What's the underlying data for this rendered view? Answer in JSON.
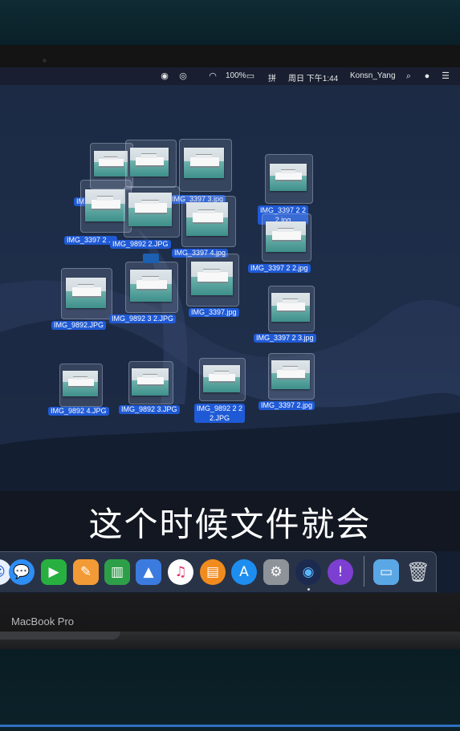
{
  "menubar": {
    "battery": "100%",
    "input_method": "拼",
    "datetime": "周日 下午1:44",
    "user": "Konsn_Yang"
  },
  "files": [
    {
      "name": "IMG_3397 2 2 2.jpg"
    },
    {
      "name": "IMG_3397 3.jpg"
    },
    {
      "name": "IMG_9892 2.JPG"
    },
    {
      "name": "IMG_3397 4.jpg"
    },
    {
      "name": "IMG_3397 2 2.jpg"
    },
    {
      "name": "IMG_3397 2 ..."
    },
    {
      "name": "IMG_9892.JPG"
    },
    {
      "name": "IMG_9892 3 2.JPG"
    },
    {
      "name": "IMG_3397.jpg"
    },
    {
      "name": "IMG_3397 2 3.jpg"
    },
    {
      "name": "IMG_9892 4.JPG"
    },
    {
      "name": "IMG_9892 3.JPG"
    },
    {
      "name": "IMG_9892 2 2 2.JPG"
    },
    {
      "name": "IMG_3397 2.jpg"
    },
    {
      "name": "IM..."
    }
  ],
  "subtitle": "这个时候文件就会",
  "laptop_brand": "MacBook Pro",
  "dock": {
    "apps": [
      {
        "name": "messages-icon"
      },
      {
        "name": "facetime-icon"
      },
      {
        "name": "pages-icon"
      },
      {
        "name": "numbers-icon"
      },
      {
        "name": "keynote-icon"
      },
      {
        "name": "itunes-icon"
      },
      {
        "name": "ibooks-icon"
      },
      {
        "name": "app-store-icon"
      },
      {
        "name": "system-preferences-icon"
      },
      {
        "name": "quicktime-icon"
      },
      {
        "name": "feedback-assistant-icon"
      },
      {
        "name": "downloads-folder-icon"
      },
      {
        "name": "trash-icon"
      }
    ]
  },
  "colors": {
    "selection_label": "#1f5ad6",
    "desktop_sky": "#1d2c47"
  }
}
